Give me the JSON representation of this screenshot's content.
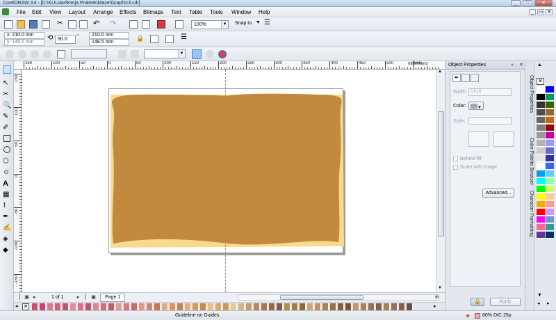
{
  "window": {
    "title": "CorelDRAW X4 - [D:\\KULIAH\\Kerja Praktek\\Maze\\Graphic3.cdr]"
  },
  "menu": {
    "items": [
      "File",
      "Edit",
      "View",
      "Layout",
      "Arrange",
      "Effects",
      "Bitmaps",
      "Text",
      "Table",
      "Tools",
      "Window",
      "Help"
    ]
  },
  "toolbar": {
    "zoom": "100%",
    "snap_to": "Snap to"
  },
  "property_bar": {
    "x": "x: 210.0 mm",
    "y": "y: 148.5 mm",
    "rotation": "90.0",
    "degree_symbol": "°",
    "width": "210.0 mm",
    "height": "148.5 mm"
  },
  "ruler": {
    "units": "millimeters",
    "h_labels": [
      "150",
      "100",
      "50",
      "0",
      "50",
      "100",
      "150",
      "200",
      "250",
      "300",
      "350",
      "400",
      "450",
      "500",
      "550"
    ],
    "v_labels": [
      "150",
      "100",
      "50",
      "0",
      "-50",
      "-100",
      "-150"
    ]
  },
  "page_nav": {
    "page_count": "1 of 1",
    "page_tab": "Page 1"
  },
  "docker": {
    "title": "Object Properties",
    "width_label": "Width:",
    "width_value": "0.0 pt",
    "color_label": "Color:",
    "style_label": "Style:",
    "behind_fill": "Behind fill",
    "scale_with_image": "Scale with image",
    "advanced_button": "Advanced...",
    "apply_button": "Apply"
  },
  "docker_tabs": [
    "Object Properties",
    "Color Palette Browser",
    "Character Formatting"
  ],
  "status": {
    "message": "Guideline on Guides",
    "fill_info": "80% DIC 25p"
  },
  "colors": {
    "scroll_fill": "#c28a3e",
    "scroll_highlight": "#f9d98e",
    "guide": "#e8743a",
    "fill_swatch": "#f0a8b0"
  },
  "vpalette_colors": [
    "#ffffff",
    "#000000",
    "#333333",
    "#4d4d4d",
    "#666666",
    "#808080",
    "#999999",
    "#b3b3b3",
    "#cccccc",
    "#e6e6e6",
    "#ffffff",
    "#00a0e9",
    "#00ffff",
    "#00ff00",
    "#ffff00",
    "#ffa500",
    "#ff0000",
    "#ff00ff",
    "#ff6699",
    "#663399",
    "#0000ff",
    "#009966",
    "#336600",
    "#996633",
    "#cc6600",
    "#990000",
    "#cc0099",
    "#9999ff",
    "#6666cc",
    "#333399",
    "#3366ff",
    "#66ccff",
    "#99ff99",
    "#ccff66",
    "#ffcc99",
    "#ff9999",
    "#cc99ff",
    "#6699cc",
    "#339999",
    "#003366"
  ],
  "hpalette_colors": [
    "#d14e6a",
    "#c9456d",
    "#e07a8a",
    "#d8607c",
    "#c65570",
    "#e88a9a",
    "#d97086",
    "#c94f6a",
    "#e2848f",
    "#d56b78",
    "#c85a68",
    "#e69a98",
    "#d87a7a",
    "#c96a6a",
    "#e49888",
    "#d88470",
    "#c9745c",
    "#e8a880",
    "#dc9060",
    "#cc8050",
    "#e6b070",
    "#d89a54",
    "#c88a44",
    "#eac08a",
    "#dcaa6a",
    "#cc9a5a",
    "#e8c8a0",
    "#dab488",
    "#c89c70",
    "#b8865a",
    "#a87654",
    "#986648",
    "#885a40",
    "#bc8b52",
    "#a47a48",
    "#8c6a3e",
    "#d0a878",
    "#c49464",
    "#b08050",
    "#9c7046",
    "#8a5c3c",
    "#7a5034",
    "#c4946c",
    "#b0805c",
    "#9c7050",
    "#886048",
    "#a88060",
    "#947054",
    "#806048",
    "#6c5040"
  ]
}
